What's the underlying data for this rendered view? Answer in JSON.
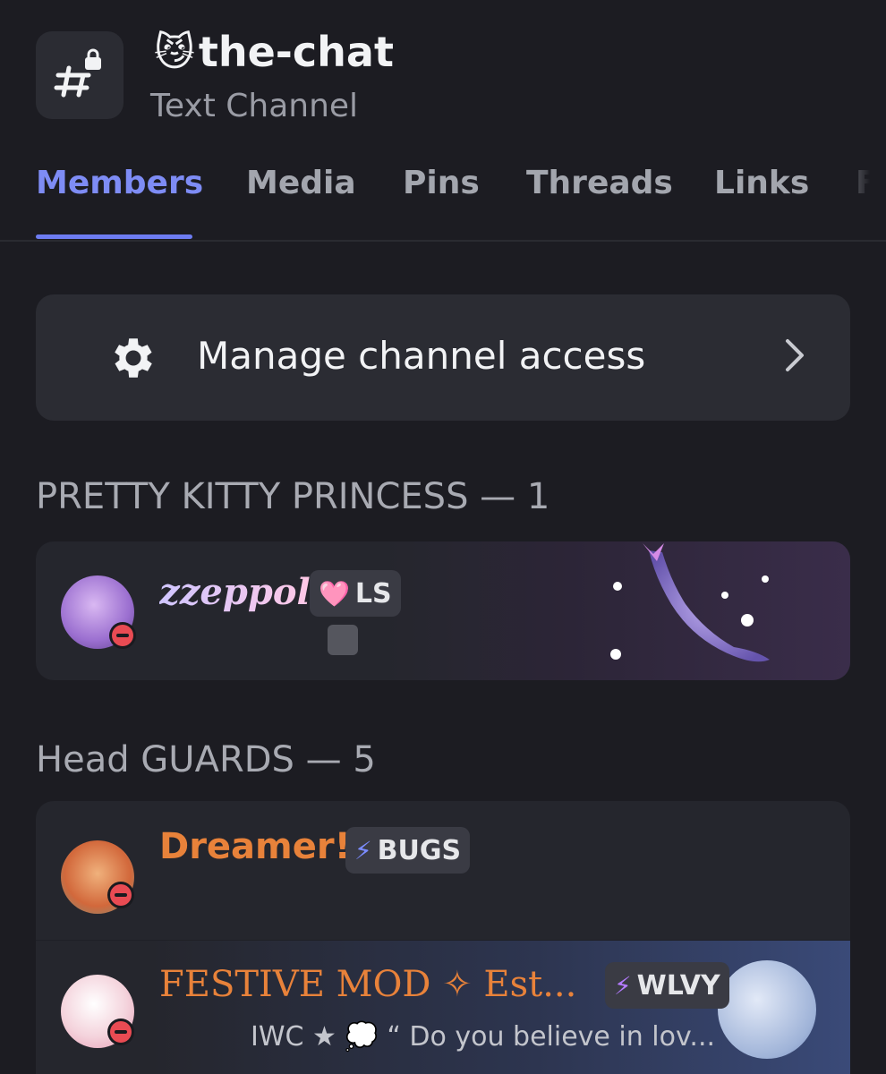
{
  "channel": {
    "emoji": "😼",
    "name": "the-chat",
    "type": "Text Channel"
  },
  "tabs": [
    {
      "label": "Members",
      "active": true
    },
    {
      "label": "Media"
    },
    {
      "label": "Pins"
    },
    {
      "label": "Threads"
    },
    {
      "label": "Links"
    },
    {
      "label": "Fi"
    }
  ],
  "manage": {
    "label": "Manage channel access",
    "icon": "gear-icon"
  },
  "sections": [
    {
      "header": "PRETTY KITTY PRINCESS — 1",
      "members": [
        {
          "name": "zzeppol",
          "tag_icon": "🩷",
          "tag": "LS",
          "status": "dnd"
        }
      ]
    },
    {
      "header": "Head GUARDS — 5",
      "members": [
        {
          "name": "Dreamer!",
          "tag_icon": "⚡",
          "tag": "BUGS",
          "status": "dnd",
          "name_color": "#e8823a"
        },
        {
          "name": "FESTIVE MOD ✧ Est...",
          "tag_icon": "⚡",
          "tag": "WLVY",
          "status": "dnd",
          "name_color": "#e8823a",
          "status_text": "IWC ★ 💭 “ Do you believe in lov..."
        }
      ]
    }
  ],
  "colors": {
    "accent": "#7e8cf5",
    "background": "#1c1c22",
    "card": "#2b2c33",
    "dnd": "#e94b53"
  }
}
